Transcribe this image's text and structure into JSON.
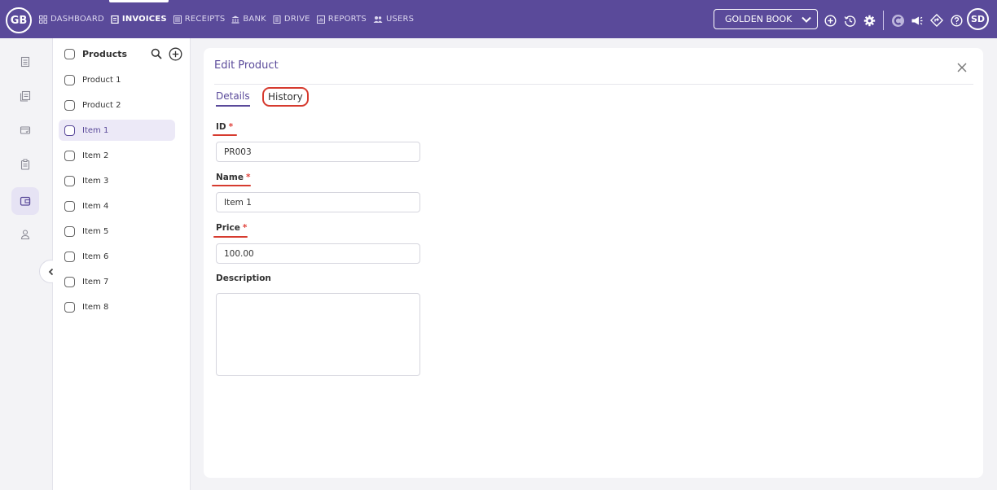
{
  "app": {
    "logo": "GB",
    "avatar": "SD",
    "company": "GOLDEN BOOK"
  },
  "nav": [
    {
      "label": "DASHBOARD",
      "icon": "grid-icon",
      "active": false
    },
    {
      "label": "INVOICES",
      "icon": "invoice-icon",
      "active": true
    },
    {
      "label": "RECEIPTS",
      "icon": "receipt-icon",
      "active": false
    },
    {
      "label": "BANK",
      "icon": "bank-icon",
      "active": false
    },
    {
      "label": "DRIVE",
      "icon": "drive-icon",
      "active": false
    },
    {
      "label": "REPORTS",
      "icon": "reports-icon",
      "active": false
    },
    {
      "label": "USERS",
      "icon": "users-icon",
      "active": false
    }
  ],
  "list": {
    "header": "Products",
    "items": [
      "Product 1",
      "Product 2",
      "Item 1",
      "Item 2",
      "Item 3",
      "Item 4",
      "Item 5",
      "Item 6",
      "Item 7",
      "Item 8"
    ],
    "selected_index": 2
  },
  "form": {
    "title": "Edit Product",
    "tabs": {
      "details": "Details",
      "history": "History"
    },
    "required_mark": "*",
    "id": {
      "label": "ID",
      "value": "PR003"
    },
    "name": {
      "label": "Name",
      "value": "Item 1"
    },
    "price": {
      "label": "Price",
      "value": "100.00"
    },
    "description": {
      "label": "Description",
      "value": ""
    }
  },
  "colors": {
    "brand": "#5a4a9a",
    "highlight": "#d63b2f"
  }
}
